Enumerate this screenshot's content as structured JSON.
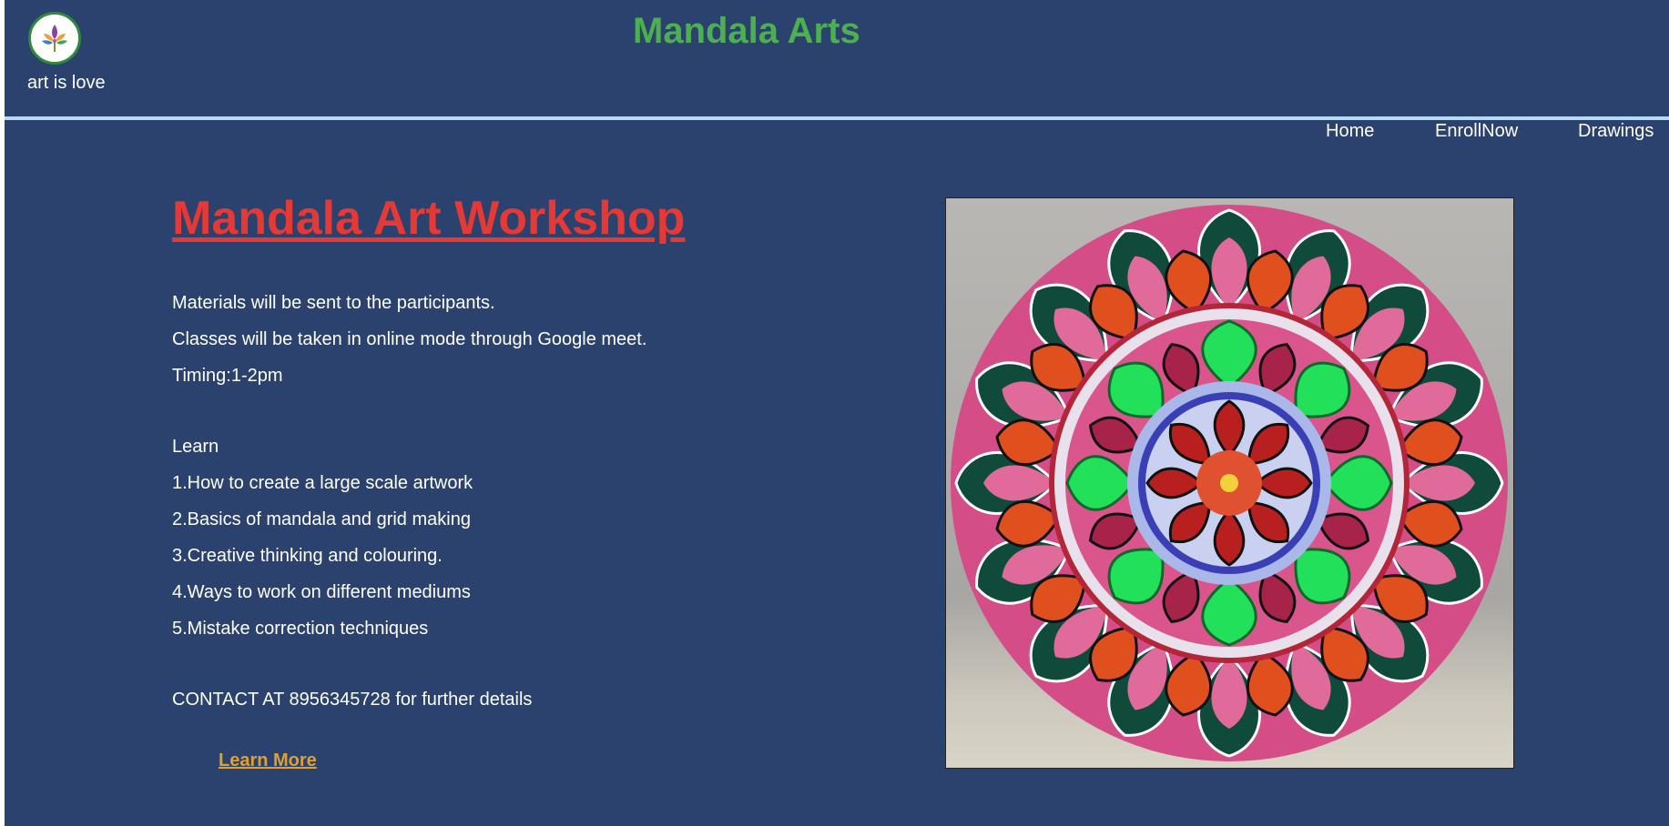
{
  "header": {
    "tagline": "art is love",
    "site_title": "Mandala Arts",
    "logo_icon": "flower-logo-icon"
  },
  "nav": {
    "items": [
      {
        "label": "Home"
      },
      {
        "label": "EnrollNow"
      },
      {
        "label": "Drawings"
      }
    ]
  },
  "main": {
    "title": "Mandala Art Workshop",
    "lines": [
      "Materials will be sent to the participants.",
      "Classes will be taken in online mode through Google meet.",
      "Timing:1-2pm",
      "Learn",
      "1.How to create a large scale artwork",
      "2.Basics of mandala and grid making",
      "3.Creative thinking and colouring.",
      "4.Ways to work on different mediums",
      "5.Mistake correction techniques",
      "CONTACT AT 8956345728 for further details"
    ],
    "learn_more": "Learn More"
  },
  "colors": {
    "background": "#2b416e",
    "title_green": "#4caf50",
    "workshop_red": "#e53935",
    "link_gold": "#e0a030",
    "divider": "#b3dcf4"
  }
}
